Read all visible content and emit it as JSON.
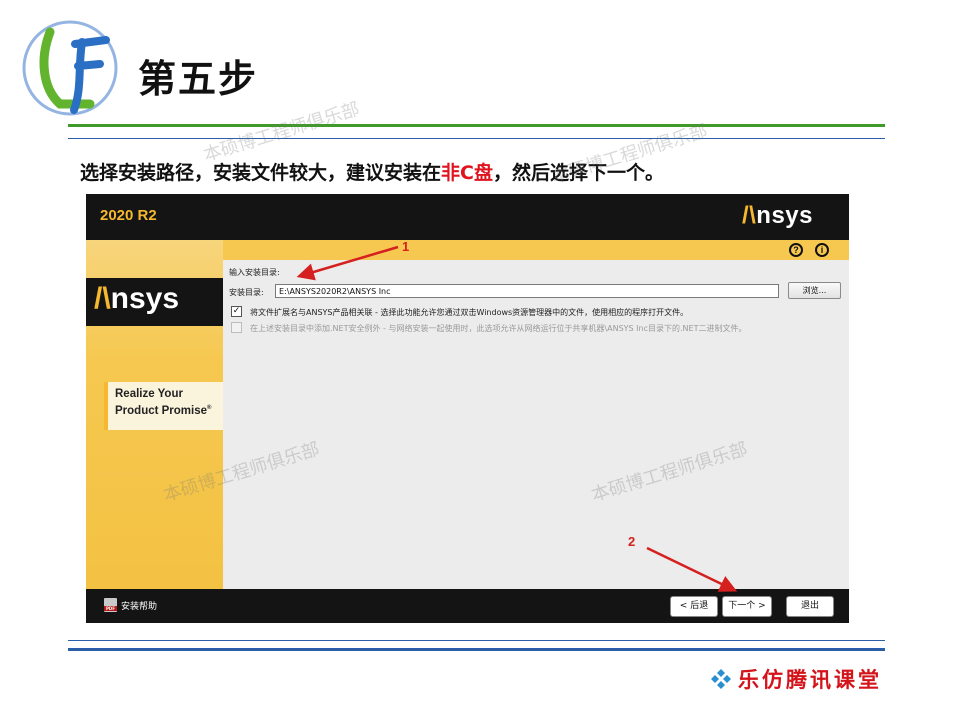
{
  "slide": {
    "title": "第五步",
    "instruction_before": "选择安装路径，安装文件较大，建议安装在",
    "instruction_highlight": "非C盘",
    "instruction_after": "，然后选择下一个。",
    "watermark": "本硕博工程师俱乐部",
    "brand": "乐仿腾讯课堂",
    "colors": {
      "accent_green": "#3f9a2a",
      "accent_blue": "#2b5ea8",
      "highlight_red": "#e0141e",
      "brand_red": "#d4141b"
    }
  },
  "installer": {
    "version": "2020 R2",
    "header_logo": {
      "accent": "/\\",
      "text": "nsys"
    },
    "side_logo": {
      "accent": "/\\",
      "text": "nsys"
    },
    "tagline_line1": "Realize Your",
    "tagline_line2": "Product Promise",
    "tagline_mark": "®",
    "help_icon": "?",
    "info_icon": "i",
    "section_label": "输入安装目录:",
    "dir_label": "安装目录:",
    "dir_value": "E:\\ANSYS2020R2\\ANSYS Inc",
    "browse_label": "浏览...",
    "option1": {
      "checked": true,
      "text": "将文件扩展名与ANSYS产品相关联 - 选择此功能允许您通过双击Windows资源管理器中的文件，使用相应的程序打开文件。"
    },
    "option2": {
      "checked": false,
      "disabled": true,
      "text": "在上述安装目录中添加.NET安全例外 - 与网络安装一起使用时，此选项允许从网络运行位于共享机器\\ANSYS Inc目录下的.NET二进制文件。"
    },
    "setup_help": "安装帮助",
    "back_label": "< 后退",
    "next_label": "下一个 >",
    "exit_label": "退出",
    "colors": {
      "brand_yellow": "#f5b82e",
      "header_black": "#141414"
    }
  },
  "annotations": {
    "arrow1_label": "1",
    "arrow2_label": "2",
    "arrow_color": "#d62020"
  }
}
